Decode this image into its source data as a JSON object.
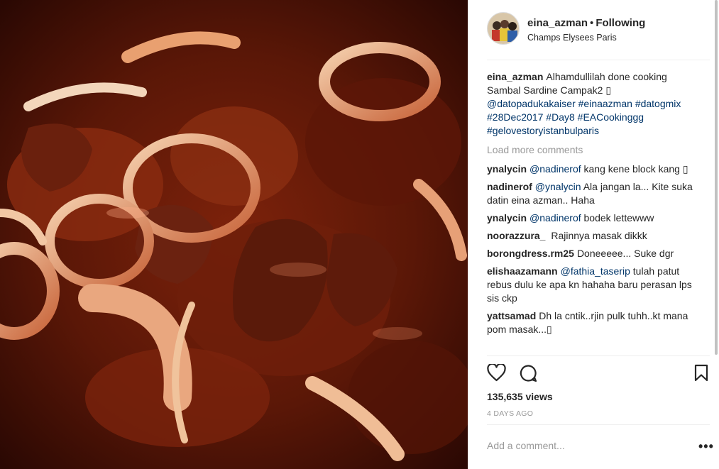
{
  "post": {
    "image_alt": "Sambal Sardine Campak2 in a pan",
    "colors": {
      "sauce_dark": "#4a1306",
      "sauce_mid": "#8a2a10",
      "onion": "#e8a07a",
      "mention": "#003569",
      "muted": "#999999"
    }
  },
  "header": {
    "username": "eina_azman",
    "dot": "•",
    "follow_label": "Following",
    "location": "Champs Elysees Paris"
  },
  "caption": {
    "user": "eina_azman",
    "text": "Alhamdullilah done cooking Sambal Sardine Campak2 ",
    "emoji": "▯",
    "mentions": [
      "@datopadukakaiser",
      "#einaazman",
      "#datogmix",
      "#28Dec2017",
      "#Day8",
      "#EACookinggg",
      "#gelovestoryistanbulparis"
    ]
  },
  "load_more": "Load more comments",
  "comments": [
    {
      "user": "ynalycin",
      "mention": "@nadinerof",
      "text": " kang kene block kang ▯"
    },
    {
      "user": "nadinerof",
      "mention": "@ynalycin",
      "text": " Ala jangan la... Kite suka datin eina azman.. Haha"
    },
    {
      "user": "ynalycin",
      "mention": "@nadinerof",
      "text": " bodek lettewww"
    },
    {
      "user": "noorazzura_",
      "mention": "",
      "text": " Rajinnya masak dikkk"
    },
    {
      "user": "borongdress.rm25",
      "mention": "",
      "text": "Doneeeee... Suke dgr"
    },
    {
      "user": "elishaazamann",
      "mention": "@fathia_taserip",
      "text": " tulah patut rebus dulu ke apa kn hahaha baru perasan lps sis ckp"
    },
    {
      "user": "yattsamad",
      "mention": "",
      "text": "Dh la cntik..rjin pulk tuhh..kt mana pom masak...▯"
    }
  ],
  "actions": {
    "like_icon": "heart-icon",
    "comment_icon": "comment-icon",
    "save_icon": "bookmark-icon"
  },
  "views": "135,635 views",
  "time": "4 DAYS AGO",
  "add_comment_placeholder": "Add a comment...",
  "more_options": "•••"
}
